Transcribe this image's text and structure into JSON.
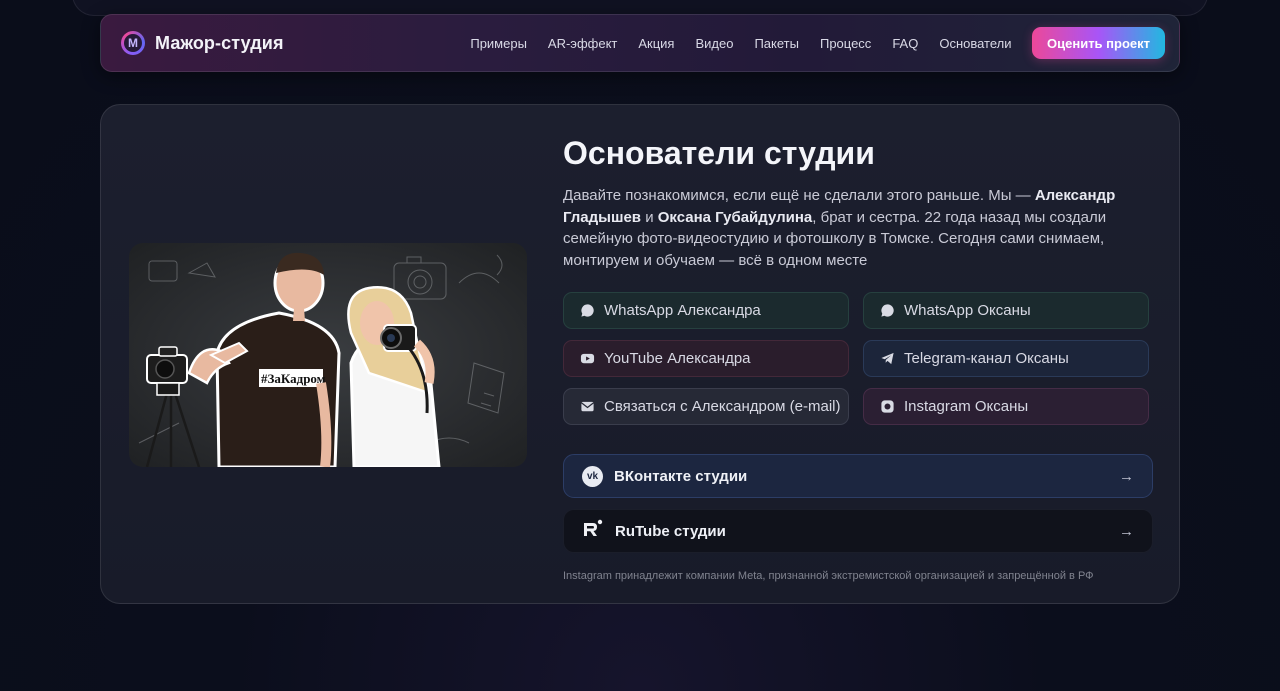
{
  "nav": {
    "logo_text": "Мажор-студия",
    "logo_letter": "M",
    "links": [
      "Примеры",
      "AR-эффект",
      "Акция",
      "Видео",
      "Пакеты",
      "Процесс",
      "FAQ",
      "Основатели"
    ],
    "cta_label": "Оценить проект"
  },
  "section": {
    "title": "Основатели студии",
    "intro_part1": "Давайте познакомимся, если ещё не сделали этого раньше. Мы — ",
    "founder_1": "Александр Гладышев",
    "intro_and": " и ",
    "founder_2": "Оксана Губайдулина",
    "intro_part2": ", брат и сестра. 22 года назад мы создали семейную фото-видеостудию и фотошколу в Томске. Сегодня сами снимаем, монтируем и обучаем — всё в одном месте",
    "photo_shirt_text": "#ЗаКадром",
    "socials": [
      {
        "label": "WhatsApp Александра",
        "icon": "whatsapp-icon",
        "variant": "wa"
      },
      {
        "label": "WhatsApp Оксаны",
        "icon": "whatsapp-icon",
        "variant": "wa"
      },
      {
        "label": "YouTube Александра",
        "icon": "youtube-icon",
        "variant": "yt"
      },
      {
        "label": "Telegram-канал Оксаны",
        "icon": "telegram-icon",
        "variant": "tg"
      },
      {
        "label": "Связаться с Александром (e-mail)",
        "icon": "mail-icon",
        "variant": "mail"
      },
      {
        "label": "Instagram Оксаны",
        "icon": "instagram-icon",
        "variant": "ig"
      }
    ],
    "vk_label": "ВКонтакте студии",
    "rutube_label": "RuTube студии",
    "arrow": "→",
    "disclaimer": "Instagram принадлежит компании Meta, признанной экстремистской организацией и запрещённой в РФ"
  },
  "colors": {
    "accent_pink": "#ec4899",
    "accent_cyan": "#22b8e0",
    "background": "#0b0e1c",
    "card": "#1c1f2e"
  }
}
